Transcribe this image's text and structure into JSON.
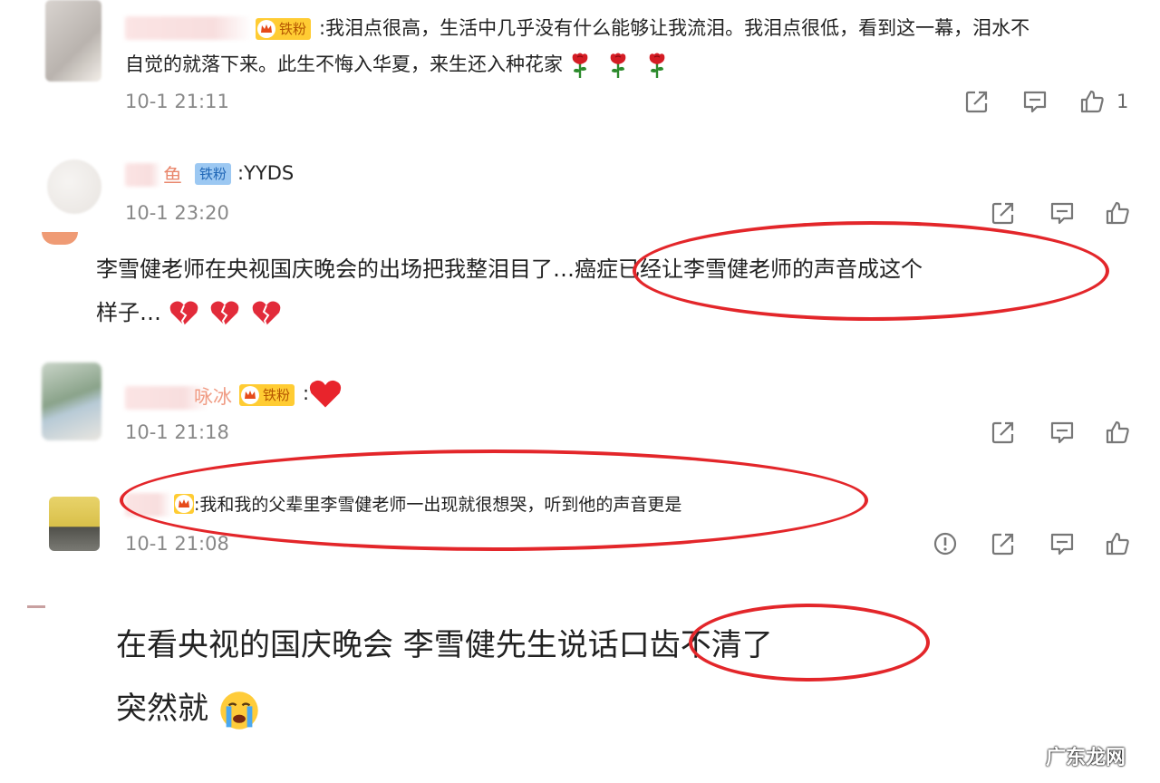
{
  "comments": [
    {
      "badge": "铁粉",
      "username": "…",
      "text_line1": ":我泪点很高，生活中几乎没有什么能够让我流泪。我泪点很低，看到这一幕，泪水不",
      "text_line2": "自觉的就落下来。此生不悔入华夏，来生还入种花家",
      "time": "10-1 21:11",
      "like_count": "1"
    },
    {
      "name_fragment": "鱼",
      "badge": "铁粉",
      "text": ":YYDS",
      "time": "10-1 23:20"
    },
    {
      "name_fragment": "咏冰",
      "badge": "铁粉",
      "time": "10-1 21:18"
    },
    {
      "text": ":我和我的父辈里李雪健老师一出现就很想哭，听到他的声音更是",
      "time": "10-1 21:08"
    }
  ],
  "post_mid": {
    "line1": "李雪健老师在央视国庆晚会的出场把我整泪目了…癌症已经让李雪健老师的声音成这个",
    "line2": "样子…"
  },
  "post_bottom": {
    "line1": "在看央视的国庆晚会 李雪健先生说话口齿不清了",
    "line2": "突然就"
  },
  "watermark": "广东龙网",
  "colors": {
    "highlight_ellipse": "#e3262a",
    "iron_badge_bg": "#9cc8f2",
    "gold_badge_bg": "#ffcc33",
    "time_text": "#888888"
  },
  "icons": [
    "share-icon",
    "comment-icon",
    "like-icon",
    "report-icon",
    "rose-icon",
    "broken-heart-icon",
    "heart-icon",
    "crying-face-icon"
  ]
}
